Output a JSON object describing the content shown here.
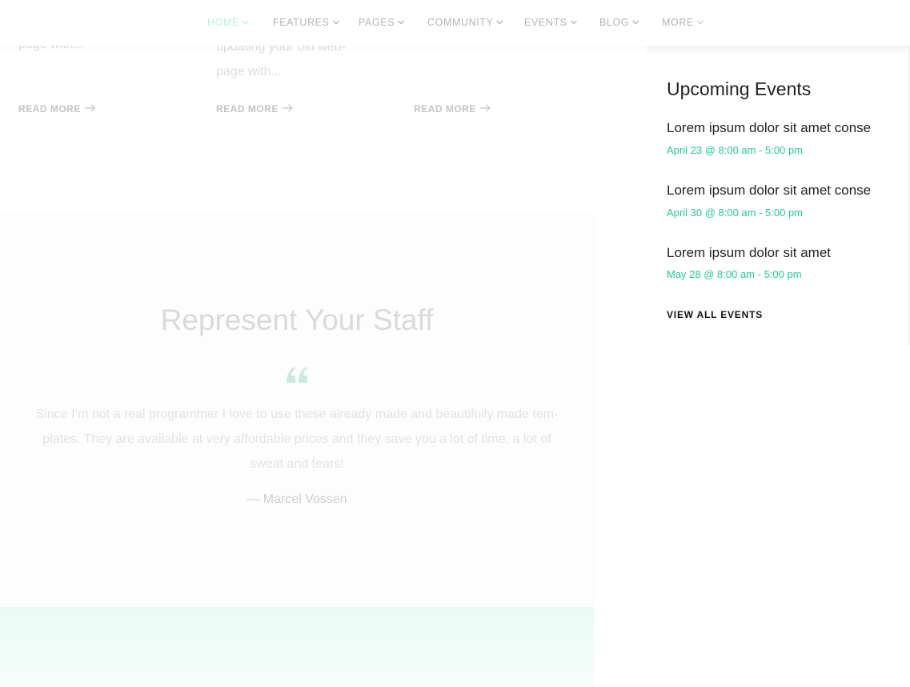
{
  "nav": {
    "items": [
      {
        "label": "HOME"
      },
      {
        "label": "FEATURES"
      },
      {
        "label": "PAGES"
      },
      {
        "label": "COMMUNITY"
      },
      {
        "label": "EVENTS"
      },
      {
        "label": "BLOG"
      },
      {
        "label": "MORE"
      }
    ],
    "active_color": "#bfeee0"
  },
  "posts": [
    {
      "excerpt_lines": [
        "page with..."
      ],
      "read_more": "READ MORE"
    },
    {
      "excerpt_lines": [
        "updating your old web-",
        "page with..."
      ],
      "read_more": "READ MORE"
    },
    {
      "excerpt_lines": [],
      "read_more": "READ MORE"
    }
  ],
  "staff": {
    "title": "Represent Your Staff",
    "quote": "Since I’m not a real programmer I love to use these already made and beautifully made tem-plates. They are available at very affordable prices and they save you a lot of time, a lot of sweat and tears!",
    "quote_lines": [
      "Since I’m not a real programmer I love to use these already made and beautifully made tem-",
      "plates. They are available at very affordable prices and they save you a lot of time, a lot of",
      "sweat and tears!"
    ],
    "author": "— Marcel Vossen"
  },
  "sidebar": {
    "heading": "Upcoming Events",
    "events": [
      {
        "title": "Lorem ipsum dolor sit amet conse",
        "date": "April 23 @ 8:00 am - 5:00 pm"
      },
      {
        "title": "Lorem ipsum dolor sit amet conse",
        "date": "April 30 @ 8:00 am - 5:00 pm"
      },
      {
        "title": "Lorem ipsum dolor sit amet",
        "date": "May 28 @ 8:00 am - 5:00 pm"
      }
    ],
    "view_all": "VIEW ALL EVENTS"
  },
  "colors": {
    "accent": "#21c998",
    "mint_background": "#e9fbf5"
  }
}
